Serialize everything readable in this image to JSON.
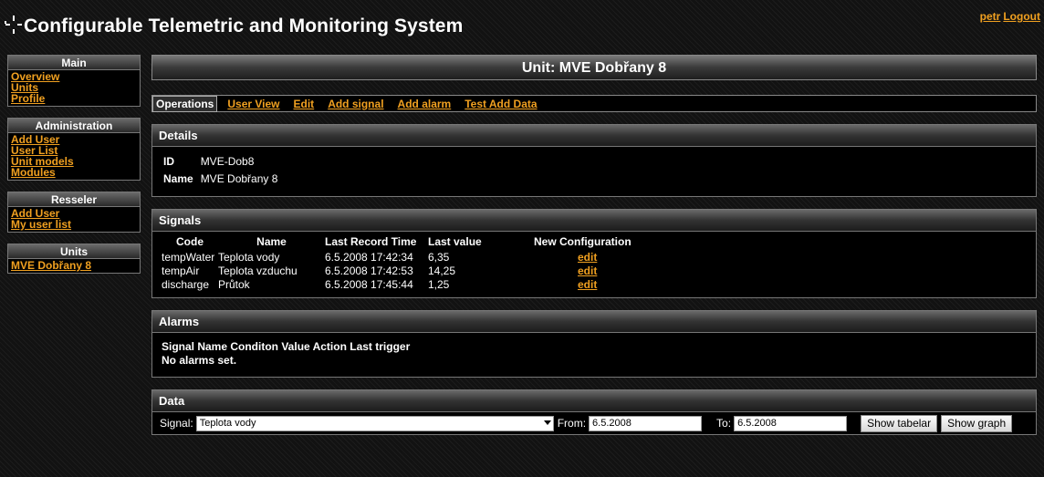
{
  "header": {
    "title": "Configurable Telemetric and Monitoring System",
    "user": "petr",
    "logout": "Logout"
  },
  "sidebar": {
    "main": {
      "title": "Main",
      "items": [
        "Overview",
        "Units",
        "Profile"
      ]
    },
    "administration": {
      "title": "Administration",
      "items": [
        "Add User",
        "User List",
        "Unit models",
        "Modules"
      ]
    },
    "resseler": {
      "title": "Resseler",
      "items": [
        "Add User",
        "My user list"
      ]
    },
    "units": {
      "title": "Units",
      "items": [
        "MVE Dobřany 8"
      ]
    }
  },
  "unit": {
    "title": "Unit: MVE Dobřany 8"
  },
  "tabs": [
    "Operations",
    "User View",
    "Edit",
    "Add signal",
    "Add alarm",
    "Test Add Data"
  ],
  "details": {
    "title": "Details",
    "id_label": "ID",
    "id_value": "MVE-Dob8",
    "name_label": "Name",
    "name_value": "MVE Dobřany 8"
  },
  "signals": {
    "title": "Signals",
    "columns": [
      "Code",
      "Name",
      "Last Record Time",
      "Last value",
      "New Configuration"
    ],
    "rows": [
      {
        "code": "tempWater",
        "name": "Teplota vody",
        "time": "6.5.2008 17:42:34",
        "value": "6,35",
        "action": "edit"
      },
      {
        "code": "tempAir",
        "name": "Teplota vzduchu",
        "time": "6.5.2008 17:42:53",
        "value": "14,25",
        "action": "edit"
      },
      {
        "code": "discharge",
        "name": "Průtok",
        "time": "6.5.2008 17:45:44",
        "value": "1,25",
        "action": "edit"
      }
    ]
  },
  "alarms": {
    "title": "Alarms",
    "header": "Signal Name Conditon Value Action Last trigger",
    "empty": "No alarms set."
  },
  "data": {
    "title": "Data",
    "signal_label": "Signal:",
    "signal_value": "Teplota vody",
    "from_label": "From:",
    "from_value": "6.5.2008",
    "to_label": "To:",
    "to_value": "6.5.2008",
    "show_tabelar": "Show tabelar",
    "show_graph": "Show graph"
  },
  "colors": {
    "link": "#f0a020",
    "background": "#151515"
  }
}
